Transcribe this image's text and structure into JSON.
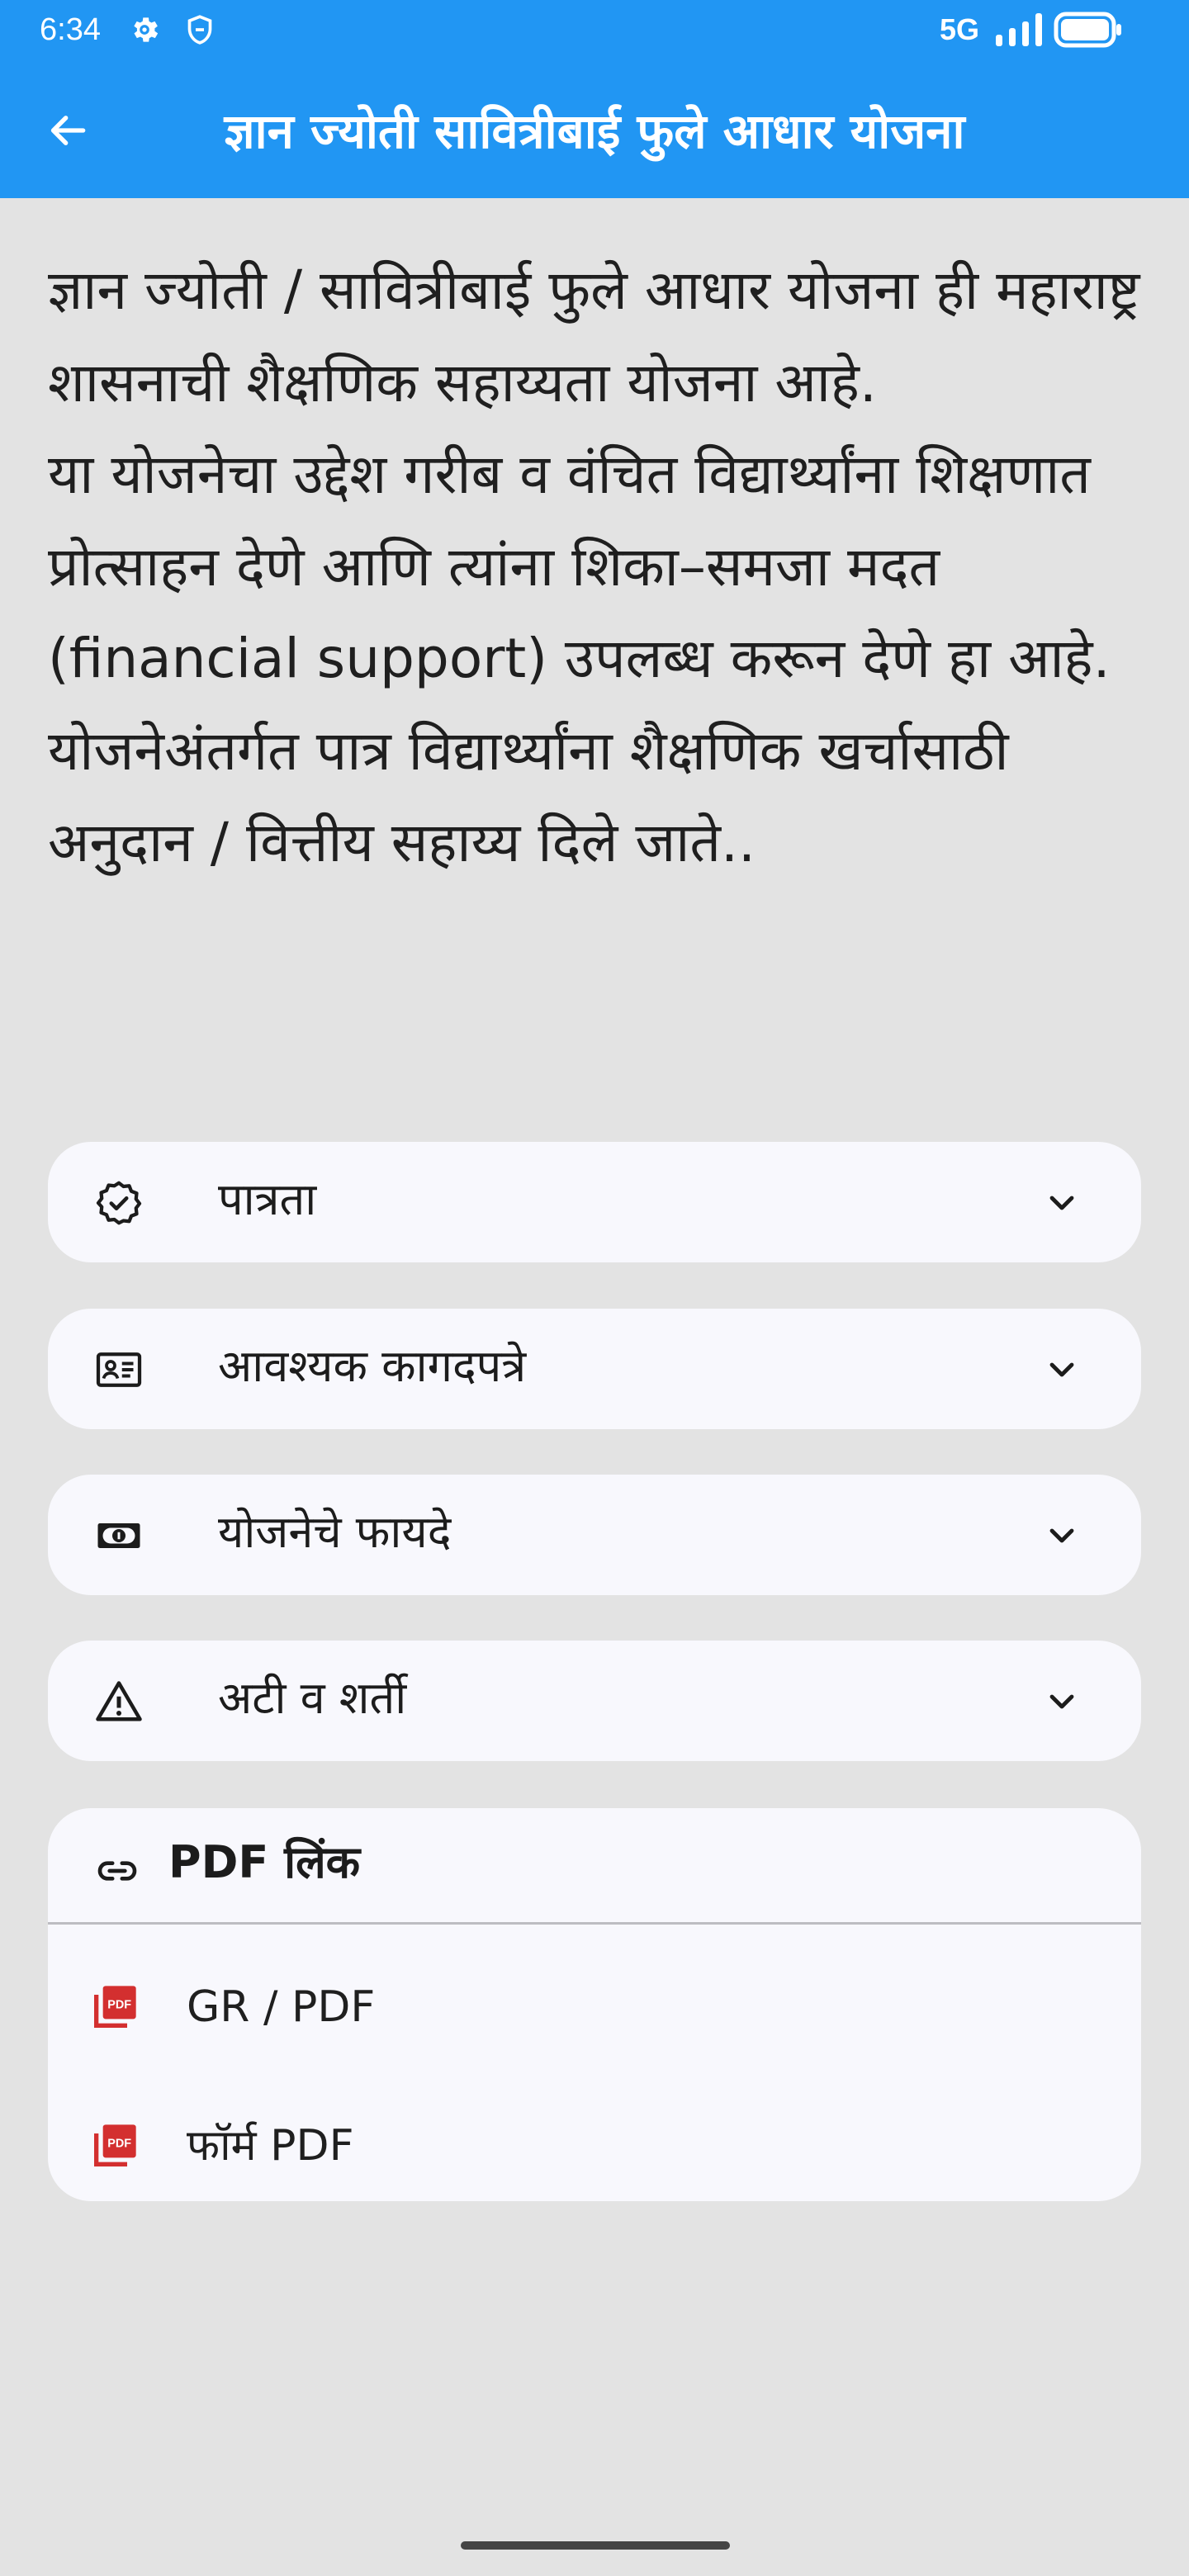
{
  "status_bar": {
    "time": "6:34",
    "network": "5G",
    "icons": [
      "gear-icon",
      "shield-icon",
      "signal-icon",
      "battery-icon"
    ]
  },
  "app_bar": {
    "title": "ज्ञान ज्योती सावित्रीबाई फुले आधार योजना",
    "back_icon": "arrow-back-icon",
    "background": "#2196f3"
  },
  "description": {
    "paragraphs": [
      "ज्ञान ज्योती / सावित्रीबाई फुले आधार योजना ही महाराष्ट्र शासनाची शैक्षणिक सहाय्यता योजना आहे.",
      "या योजनेचा उद्देश गरीब व वंचित विद्यार्थ्यांना शिक्षणात प्रोत्साहन देणे आणि त्यांना शिका–समजा मदत (financial support) उपलब्ध करून देणे हा आहे.",
      "योजनेअंतर्गत पात्र विद्यार्थ्यांना शैक्षणिक खर्चासाठी अनुदान / वित्तीय सहाय्य दिले जाते.."
    ]
  },
  "sections": [
    {
      "label": "पात्रता",
      "icon": "verified-badge-icon"
    },
    {
      "label": "आवश्यक कागदपत्रे",
      "icon": "id-card-icon"
    },
    {
      "label": "योजनेचे फायदे",
      "icon": "money-icon"
    },
    {
      "label": "अटी व शर्ती",
      "icon": "warning-icon"
    }
  ],
  "pdf_links": {
    "title": "PDF लिंक",
    "icon": "link-icon",
    "items": [
      {
        "label": "GR / PDF",
        "icon": "pdf-icon"
      },
      {
        "label": "फॉर्म PDF",
        "icon": "pdf-icon"
      }
    ],
    "pdf_icon_color": "#d32f2f"
  }
}
